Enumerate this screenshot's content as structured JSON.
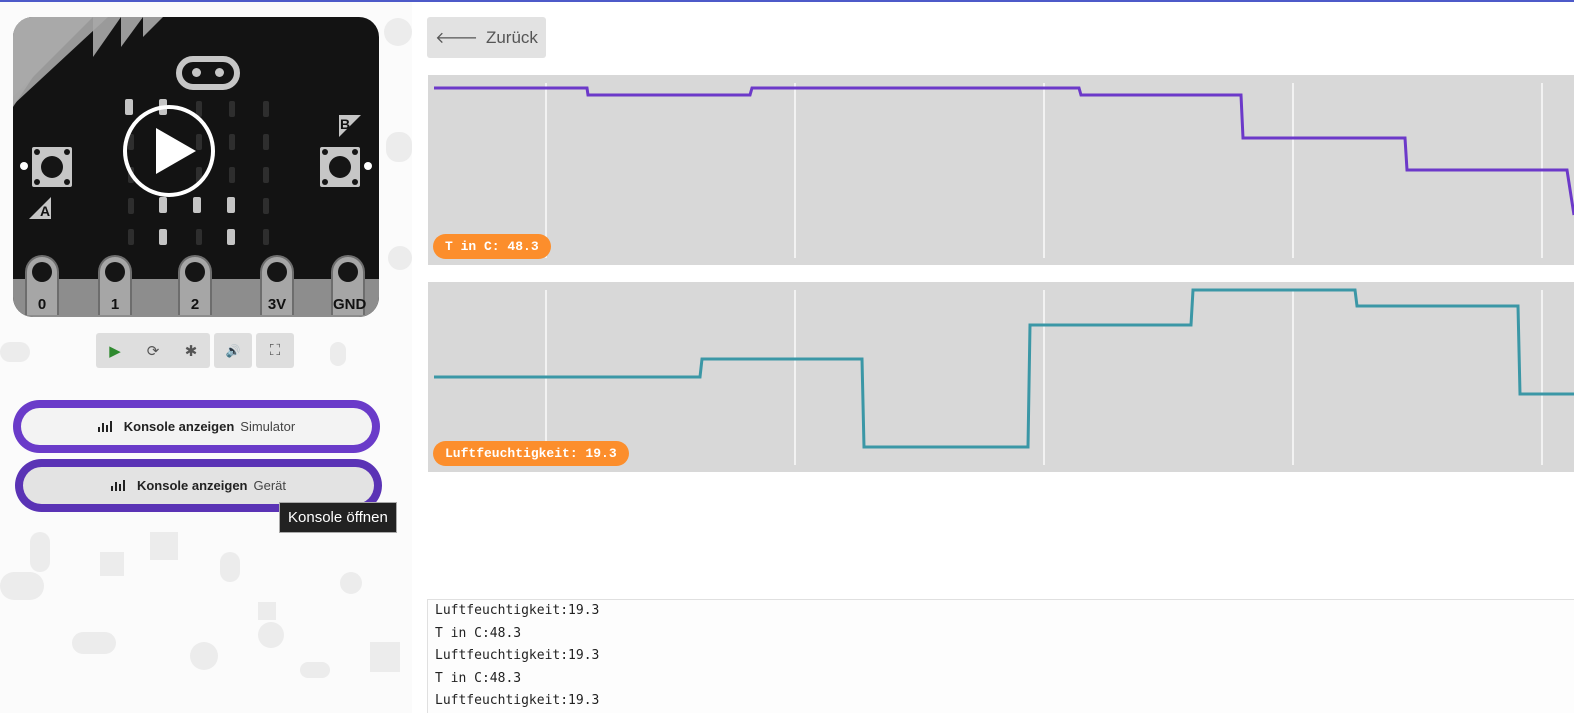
{
  "simulator": {
    "pin_labels": [
      "0",
      "1",
      "2",
      "3V",
      "GND"
    ],
    "button_a_label": "A",
    "button_b_label": "B",
    "controls": [
      {
        "name": "play-icon",
        "glyph": "▶"
      },
      {
        "name": "restart-icon",
        "glyph": "⟳"
      },
      {
        "name": "debug-icon",
        "glyph": "✱"
      },
      {
        "name": "sound-icon",
        "glyph": "🔊"
      },
      {
        "name": "fullscreen-icon",
        "glyph": "⛶"
      }
    ]
  },
  "console_buttons": [
    {
      "label": "Konsole anzeigen",
      "sub": "Simulator"
    },
    {
      "label": "Konsole anzeigen",
      "sub": "Gerät"
    }
  ],
  "tooltip": "Konsole öffnen",
  "back_button": {
    "label": "Zurück",
    "icon": "arrow-left-icon"
  },
  "charts": [
    {
      "badge": "T in C: 48.3",
      "color": "#6c39c9"
    },
    {
      "badge": "Luftfeuchtigkeit: 19.3",
      "color": "#3b97a6"
    }
  ],
  "console_log": [
    "Luftfeuchtigkeit:19.3",
    "T in C:48.3",
    "Luftfeuchtigkeit:19.3",
    "T in C:48.3",
    "Luftfeuchtigkeit:19.3"
  ]
}
